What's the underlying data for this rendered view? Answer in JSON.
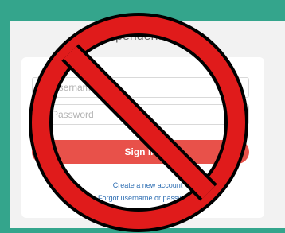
{
  "login": {
    "title": "Independent Sign In",
    "username_placeholder": "Username",
    "password_placeholder": "Password",
    "signin_label": "Sign In",
    "create_account_link": "Create a new account",
    "forgot_link": "Forgot username or password?"
  },
  "icons": {
    "username": "user-icon",
    "password": "lock-icon",
    "overlay": "prohibition-icon"
  },
  "colors": {
    "background": "#34a58c",
    "button": "#e8514a",
    "link": "#2f6fb3",
    "prohibition_red": "#e01b1b"
  }
}
